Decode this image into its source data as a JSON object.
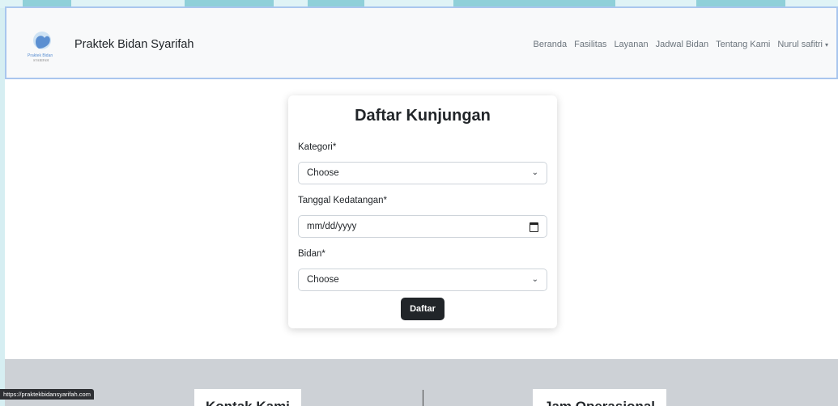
{
  "brand": {
    "name": "Praktek Bidan Syarifah",
    "logo_text": "Praktek Bidan",
    "logo_subtext": "SYARIFAH"
  },
  "nav": {
    "items": [
      "Beranda",
      "Fasilitas",
      "Layanan",
      "Jadwal Bidan",
      "Tentang Kami"
    ],
    "user": "Nurul safitri"
  },
  "form": {
    "title": "Daftar Kunjungan",
    "kategori_label": "Kategori*",
    "kategori_value": "Choose",
    "tanggal_label": "Tanggal Kedatangan*",
    "tanggal_placeholder": "mm/dd/yyyy",
    "bidan_label": "Bidan*",
    "bidan_value": "Choose",
    "submit_label": "Daftar"
  },
  "footer": {
    "kontak_title": "Kontak Kami",
    "jam_title": "Jam Operasional"
  },
  "status_bar": {
    "url": "https://praktekbidansyarifah.com"
  },
  "colors": {
    "accent": "#212529",
    "navbar_border": "#a9c6ee",
    "footer_bg": "#cdd1d6"
  }
}
